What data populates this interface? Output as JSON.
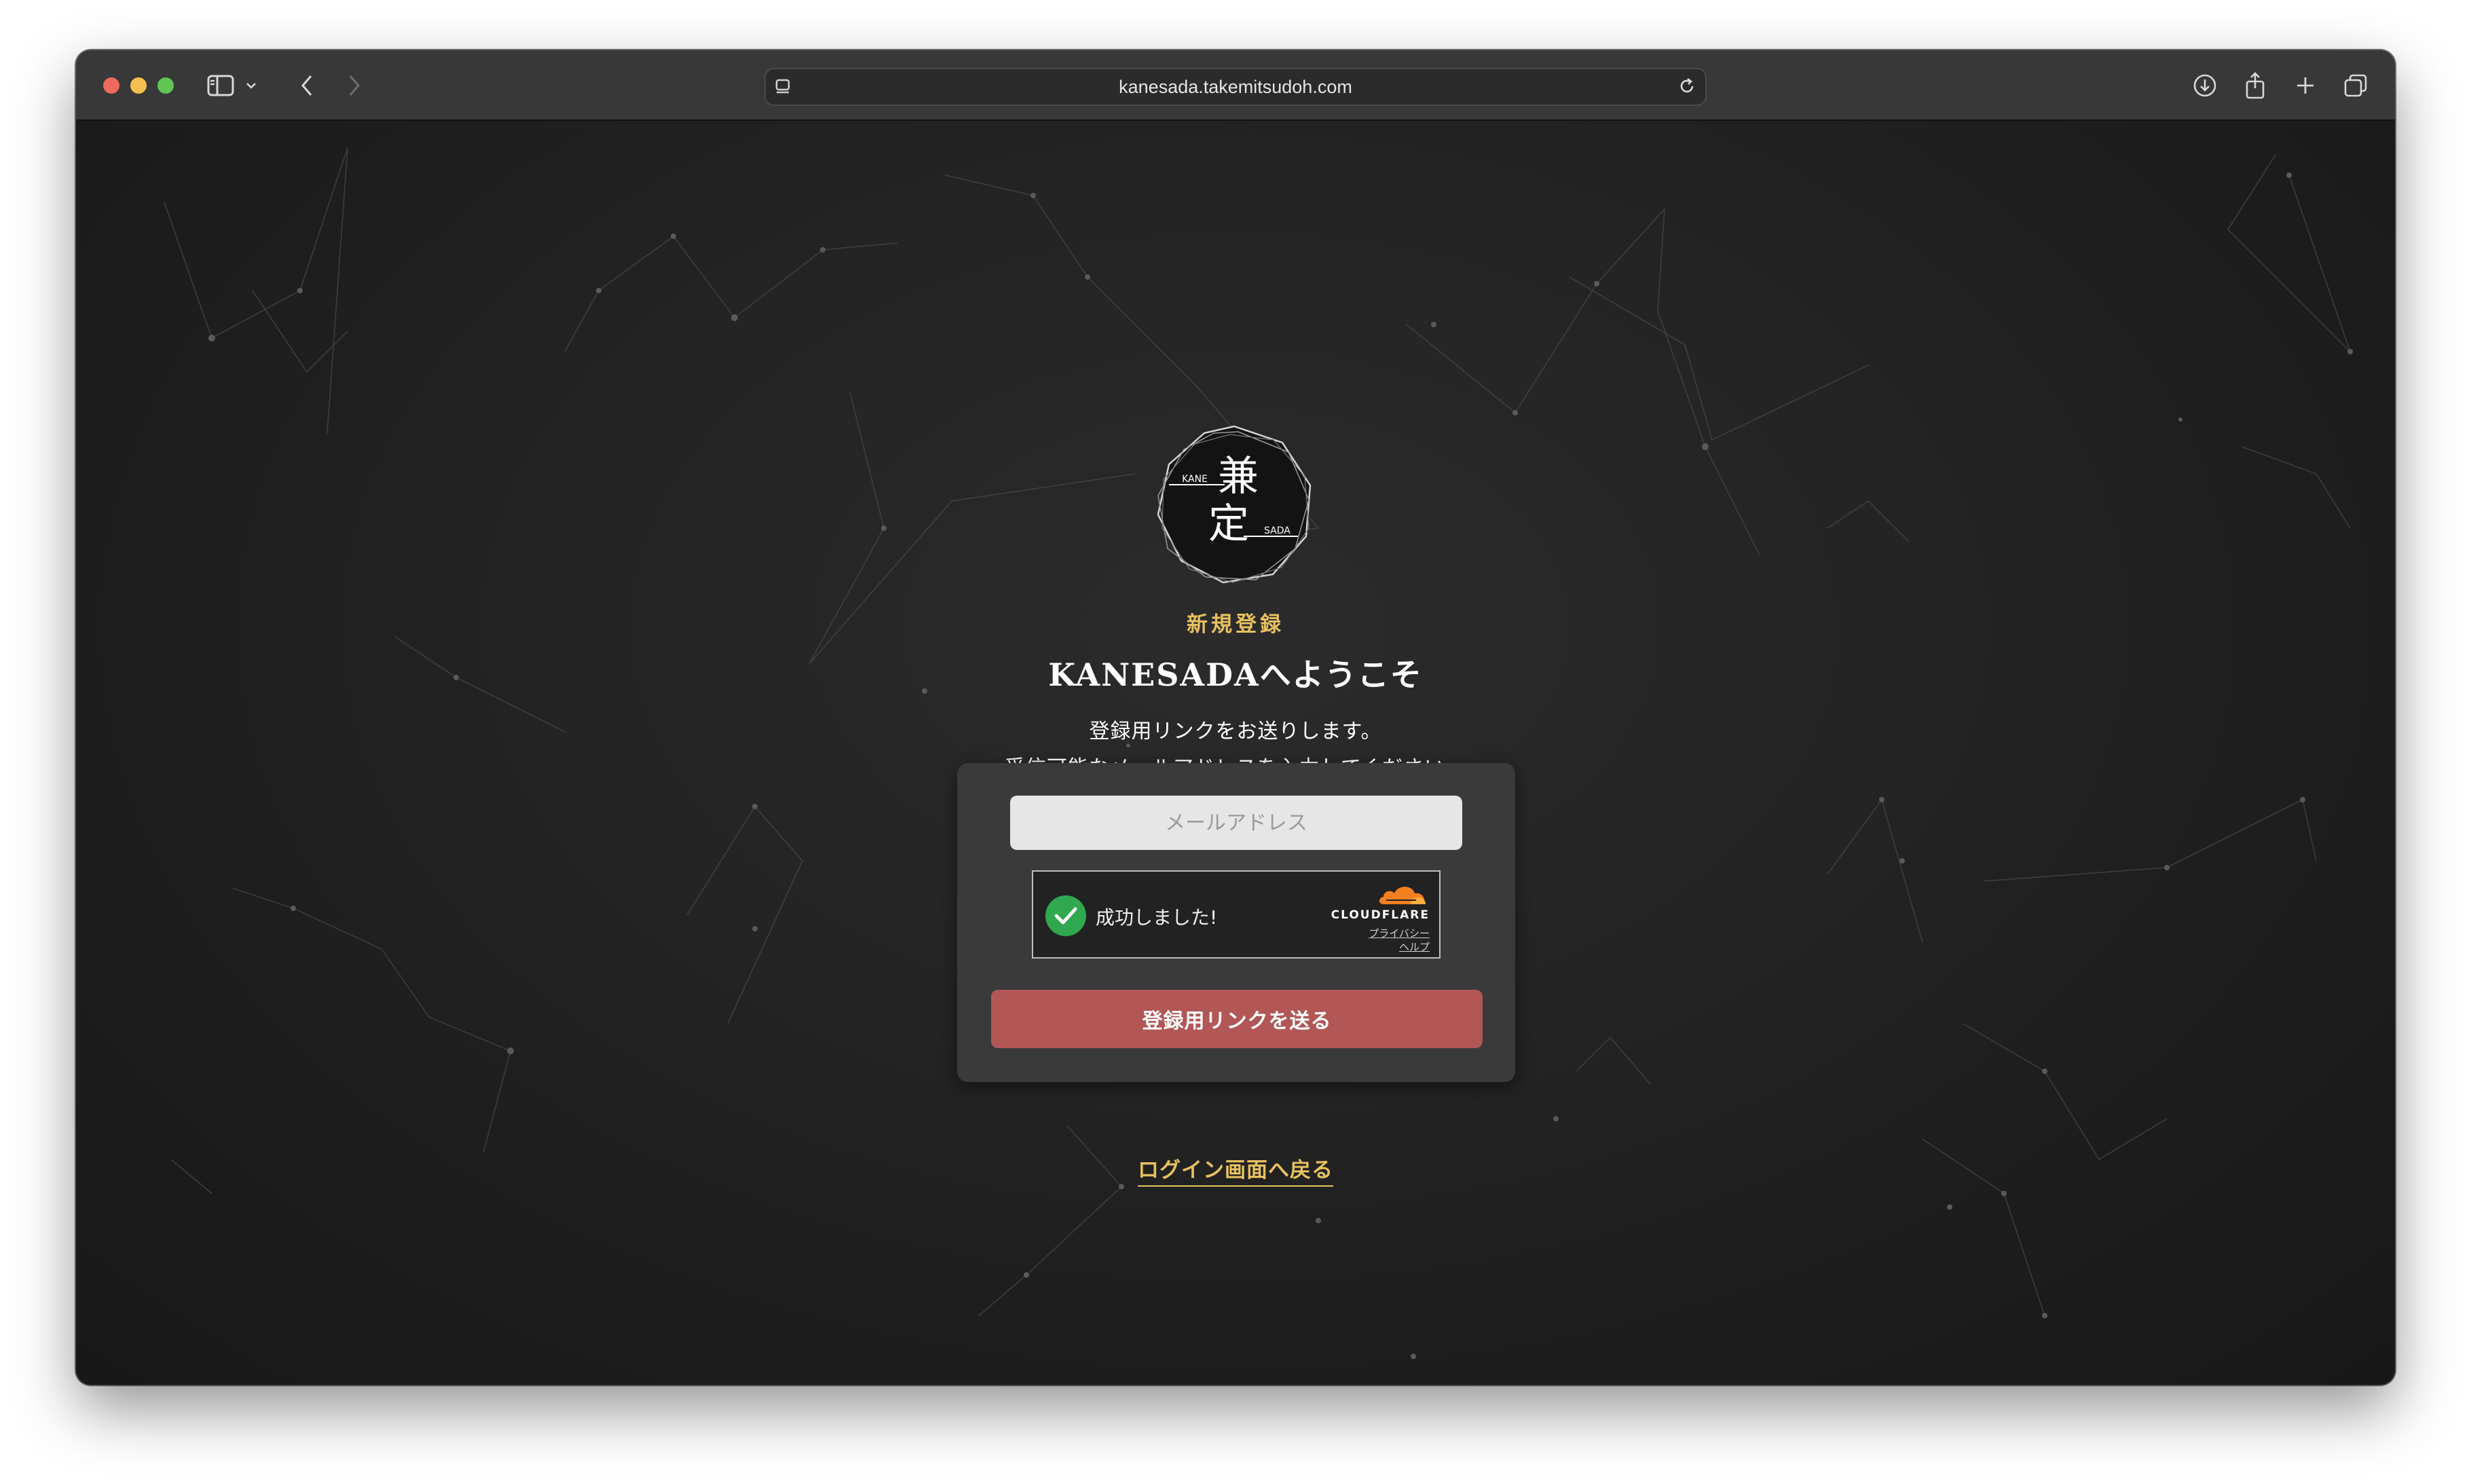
{
  "browser": {
    "url": "kanesada.takemitsudoh.com",
    "icons": {
      "sidebar": "sidebar-icon",
      "back": "chevron-left-icon",
      "forward": "chevron-right-icon",
      "reload": "reload-icon",
      "download": "download-icon",
      "share": "share-icon",
      "new_tab": "plus-icon",
      "tabs": "tabs-overview-icon"
    }
  },
  "logo": {
    "kanji_top": "兼",
    "kanji_bottom": "定",
    "label_left": "KANE",
    "label_right": "SADA"
  },
  "page": {
    "subtitle": "新規登録",
    "heading": "KANESADAへようこそ",
    "description_line1": "登録用リンクをお送りします。",
    "description_line2": "受信可能なメールアドレスを入力してください。"
  },
  "form": {
    "email_placeholder": "メールアドレス",
    "email_value": "",
    "submit_label": "登録用リンクを送る"
  },
  "turnstile": {
    "status": "成功しました!",
    "brand": "CLOUDFLARE",
    "privacy": "プライバシー",
    "help": "ヘルプ",
    "brand_color": "#f38020"
  },
  "footer": {
    "back_link": "ログイン画面へ戻る"
  },
  "colors": {
    "accent_gold": "#e6c15f",
    "button_red": "#b25656",
    "success_green": "#2fa84f"
  }
}
